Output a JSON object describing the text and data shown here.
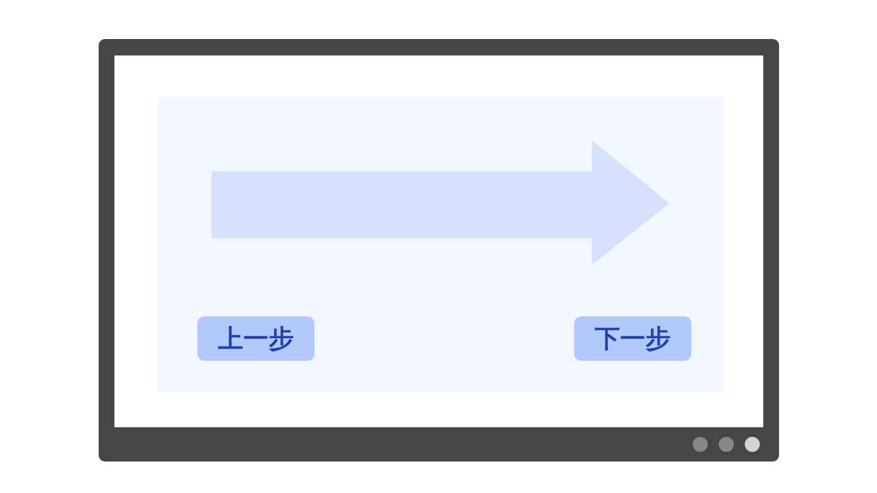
{
  "screen": {
    "buttons": [
      {
        "label": "上一步"
      },
      {
        "label": "下一步"
      }
    ]
  },
  "indicator_dots": [
    {
      "selected": false
    },
    {
      "selected": false
    },
    {
      "selected": true
    }
  ]
}
